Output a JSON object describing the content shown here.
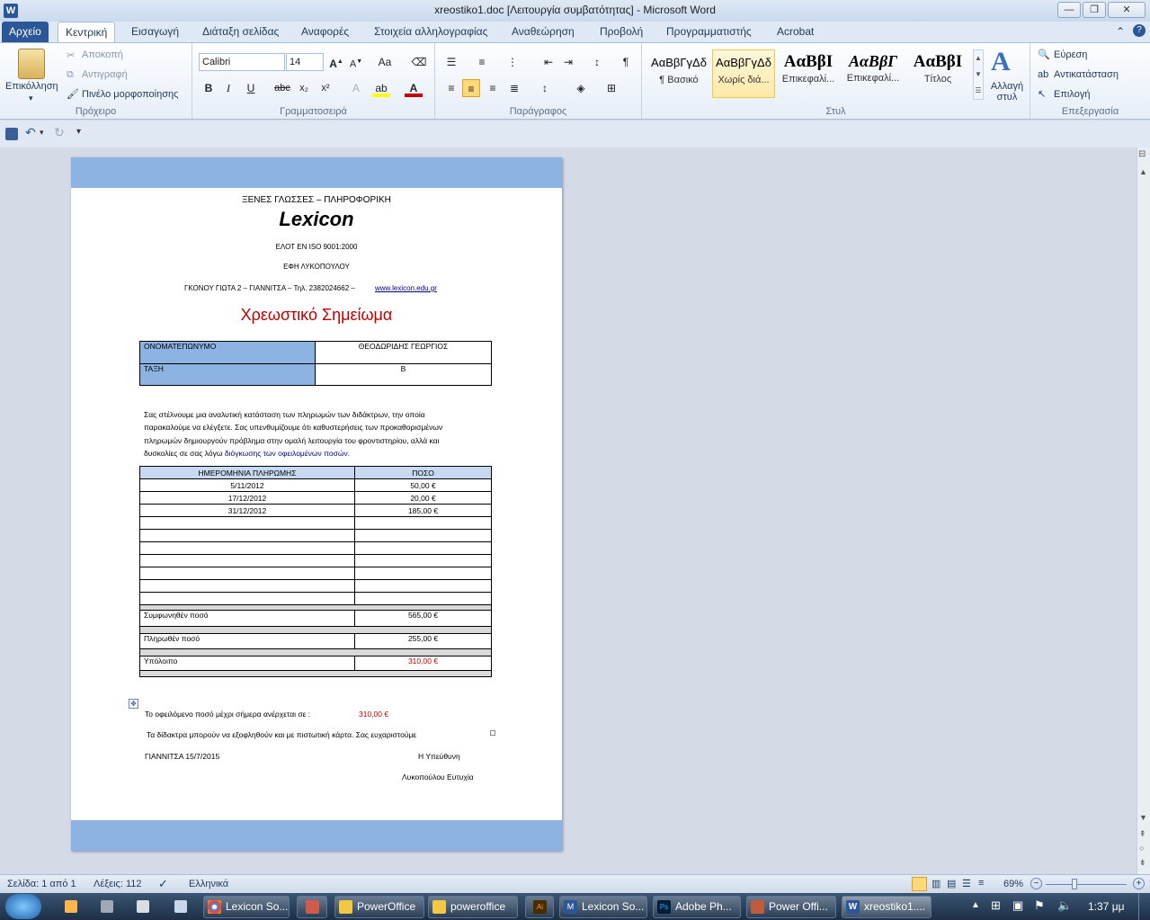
{
  "titlebar": {
    "title": "xreostiko1.doc [Λειτουργία συμβατότητας] - Microsoft Word",
    "min": "—",
    "max": "❐",
    "close": "✕"
  },
  "tabs": [
    "Αρχείο",
    "Κεντρική",
    "Εισαγωγή",
    "Διάταξη σελίδας",
    "Αναφορές",
    "Στοιχεία αλληλογραφίας",
    "Αναθεώρηση",
    "Προβολή",
    "Προγραμματιστής",
    "Acrobat"
  ],
  "ribbon": {
    "clipboard": {
      "paste": "Επικόλληση",
      "cut": "Αποκοπή",
      "copy": "Αντιγραφή",
      "format_painter": "Πινέλο μορφοποίησης",
      "label": "Πρόχειρο"
    },
    "font": {
      "name": "Calibri",
      "size": "14",
      "label": "Γραμματοσειρά"
    },
    "paragraph": {
      "label": "Παράγραφος"
    },
    "styles": {
      "items": [
        {
          "sample": "ΑαΒβΓγΔδ",
          "name": "¶ Βασικό"
        },
        {
          "sample": "ΑαΒβΓγΔδ",
          "name": "Χωρίς διά..."
        },
        {
          "sample": "ΑαΒβΙ",
          "name": "Επικεφαλί..."
        },
        {
          "sample": "ΑαΒβΓ",
          "name": "Επικεφαλί..."
        },
        {
          "sample": "ΑαΒβΙ",
          "name": "Τίτλος"
        }
      ],
      "change": "Αλλαγή στυλ",
      "label": "Στυλ"
    },
    "editing": {
      "find": "Εύρεση",
      "replace": "Αντικατάσταση",
      "select": "Επιλογή",
      "label": "Επεξεργασία"
    }
  },
  "doc": {
    "header1": "ΞΕΝΕΣ ΓΛΩΣΣΕΣ – ΠΛΗΡΟΦΟΡΙΚΗ",
    "brand": "Lexicon",
    "cert": "ΕΛΟΤ ΕΝ ISO 9001:2000",
    "owner": "ΕΦΗ ΛΥΚΟΠΟΥΛΟΥ",
    "address": "ΓΚΟΝΟΥ ΓΙΩΤΑ 2 – ΓΙΑΝΝΙΤΣΑ – Τηλ. 2382024662 –",
    "website": "www.lexicon.edu.gr",
    "title": "Χρεωστικό Σημείωμα",
    "info_rows": [
      {
        "label": "ΟΝΟΜΑΤΕΠΩΝΥΜΟ",
        "value": "ΘΕΟΔΩΡΙΔΗΣ ΓΕΩΡΓΙΟΣ"
      },
      {
        "label": "ΤΑΞΗ",
        "value": "Β"
      }
    ],
    "paragraph_lines": [
      "Σας στέλνουμε μια αναλυτική κατάσταση των πληρωμών των διδάκτρων, την οποία",
      "παρακαλούμε να ελέγξετε. Σας υπενθυμίζουμε ότι καθυστερήσεις των προκαθορισμένων",
      "πληρωμών δημιουργούν πρόβλημα στην ομαλή λειτουργία του φροντιστηρίου, αλλά και",
      "δυσκολίες σε σας λόγω"
    ],
    "paragraph_link": "διόγκωσης των οφειλομένων ποσών",
    "payments_header": {
      "date": "ΗΜΕΡΟΜΗΝΙΑ ΠΛΗΡΩΜΗΣ",
      "amount": "ΠΟΣΟ"
    },
    "payments": [
      {
        "date": "5/11/2012",
        "amount": "50,00 €"
      },
      {
        "date": "17/12/2012",
        "amount": "20,00 €"
      },
      {
        "date": "31/12/2012",
        "amount": "185,00 €"
      },
      {
        "date": "",
        "amount": ""
      },
      {
        "date": "",
        "amount": ""
      },
      {
        "date": "",
        "amount": ""
      },
      {
        "date": "",
        "amount": ""
      },
      {
        "date": "",
        "amount": ""
      },
      {
        "date": "",
        "amount": ""
      },
      {
        "date": "",
        "amount": ""
      }
    ],
    "agreed_label": "Συμφωνηθέν ποσό",
    "agreed_value": "565,00 €",
    "paid_label": "Πληρωθέν ποσό",
    "paid_value": "255,00 €",
    "balance_label": "Υπόλοιπο",
    "balance_value": "310,00 €",
    "owed_text": "Το οφειλόμενο ποσό μέχρι σήμερα ανέρχεται σε :",
    "owed_value": "310,00 €",
    "card_text": "Τα δίδακτρα μπορούν να εξοφληθούν και με πιστωτική κάρτα.   Σας ευχαριστούμε",
    "place_date": "ΓΙΑΝΝΙΤΣΑ  15/7/2015",
    "responsible": "Η  Υπεύθυνη",
    "signature": "Λυκοπούλου Ευτυχία"
  },
  "status": {
    "page": "Σελίδα: 1 από 1",
    "words": "Λέξεις: 112",
    "lang": "Ελληνικά",
    "zoom": "69%"
  },
  "taskbar": {
    "items": [
      "Lexicon So...",
      "",
      "PowerOffice",
      "poweroffice",
      "",
      "Lexicon So...",
      "Adobe Ph...",
      "Power Offi...",
      "xreostiko1...."
    ],
    "time": "1:37 μμ"
  },
  "colors": {
    "accent": "#2b5797",
    "band": "#8db3e2",
    "title_red": "#c00000",
    "link": "#000080"
  }
}
